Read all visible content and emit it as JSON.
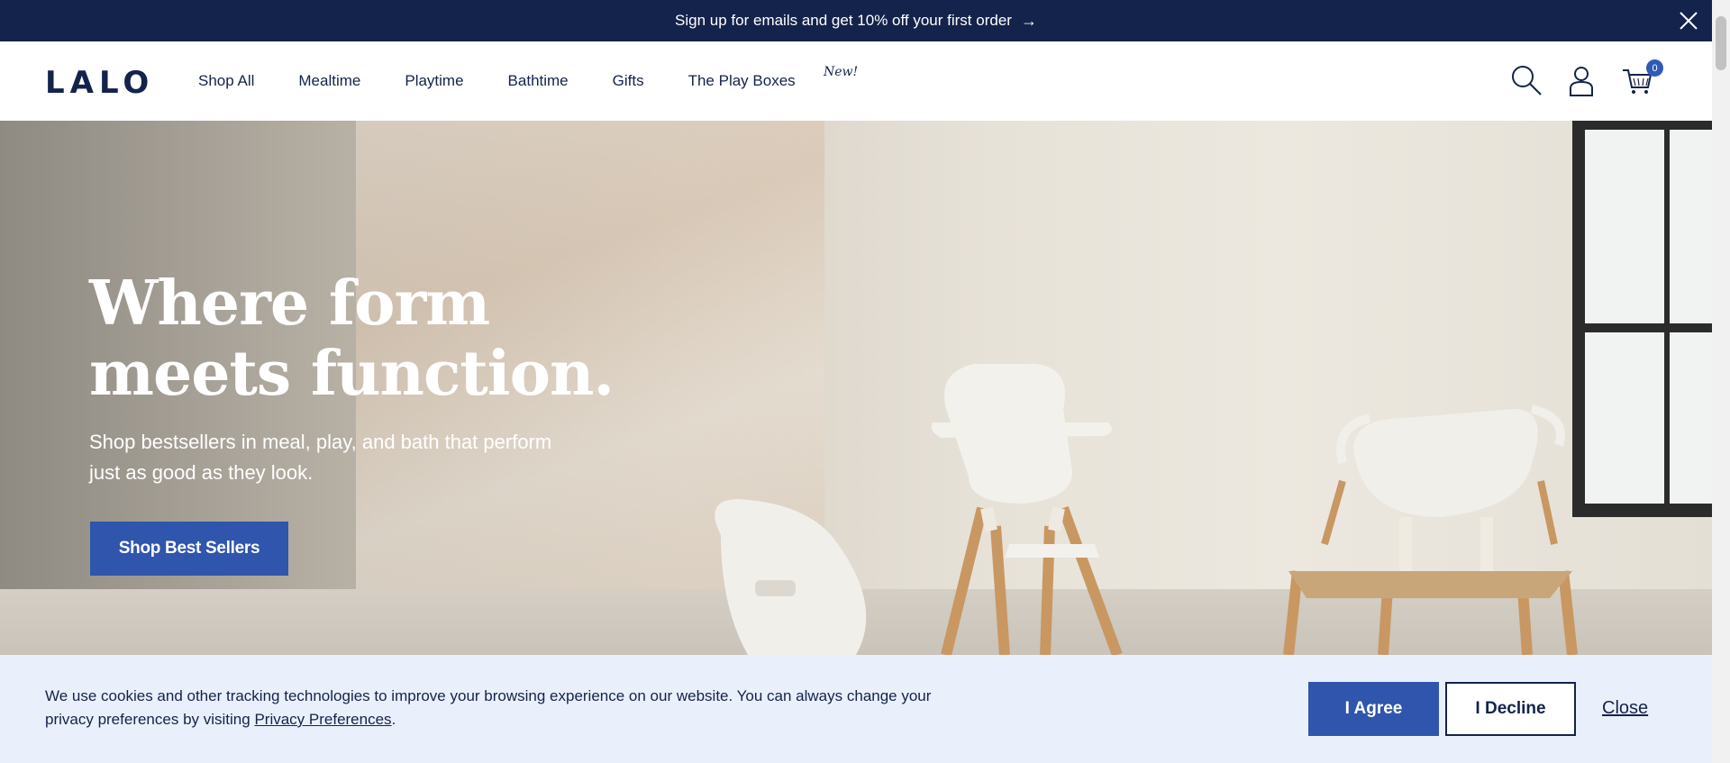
{
  "announcement": {
    "text": "Sign up for emails and get 10% off your first order",
    "arrow": "→",
    "close_icon": "close-icon"
  },
  "header": {
    "logo": "LALO",
    "nav": [
      {
        "label": "Shop All"
      },
      {
        "label": "Mealtime"
      },
      {
        "label": "Playtime"
      },
      {
        "label": "Bathtime"
      },
      {
        "label": "Gifts"
      },
      {
        "label": "The Play Boxes"
      }
    ],
    "new_badge": "New!",
    "icons": [
      "search-icon",
      "account-icon",
      "cart-icon"
    ],
    "cart_count": "0"
  },
  "hero": {
    "title": "Where form meets function.",
    "subtitle": "Shop bestsellers in meal, play, and bath that perform just as good as they look.",
    "cta_label": "Shop Best Sellers"
  },
  "cookie_banner": {
    "text_before_link": "We use cookies and other tracking technologies to improve your browsing experience on our website. You can always change your privacy preferences by visiting ",
    "link_text": "Privacy Preferences",
    "text_after_link": ".",
    "agree_label": "I Agree",
    "decline_label": "I Decline",
    "close_label": "Close"
  },
  "colors": {
    "navy": "#14234b",
    "accent_blue": "#2f55ad",
    "cookie_bg": "#eaf0fb"
  }
}
